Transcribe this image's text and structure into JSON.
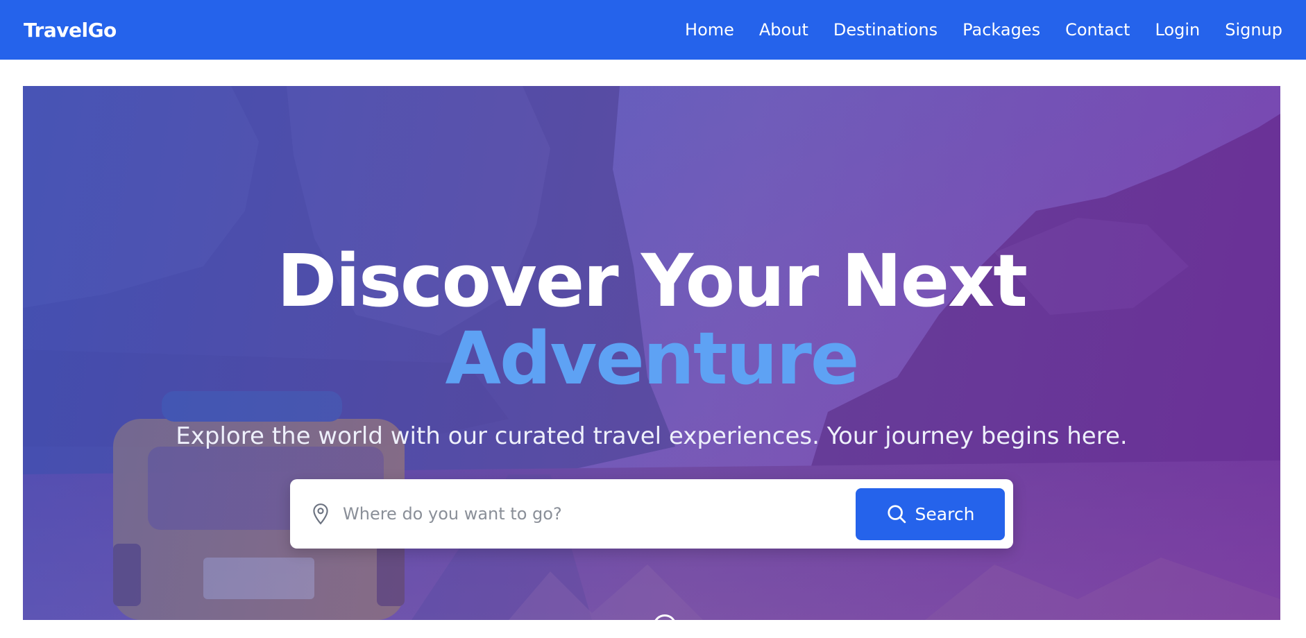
{
  "brand": {
    "name": "TravelGo"
  },
  "nav": {
    "items": [
      {
        "label": "Home"
      },
      {
        "label": "About"
      },
      {
        "label": "Destinations"
      },
      {
        "label": "Packages"
      },
      {
        "label": "Contact"
      },
      {
        "label": "Login"
      },
      {
        "label": "Signup"
      }
    ]
  },
  "hero": {
    "title_line1": "Discover Your Next",
    "title_line2": "Adventure",
    "subtitle": "Explore the world with our curated travel experiences. Your journey begins here.",
    "background_icon": "canyon-road-van-photo"
  },
  "search": {
    "placeholder": "Where do you want to go?",
    "value": "",
    "button_label": "Search",
    "input_icon": "map-pin-icon",
    "button_icon": "search-icon"
  },
  "colors": {
    "primary": "#2563eb",
    "accent_title": "#5ea2f4",
    "overlay_start": "#3b52c4",
    "overlay_end": "#7e22a0"
  }
}
